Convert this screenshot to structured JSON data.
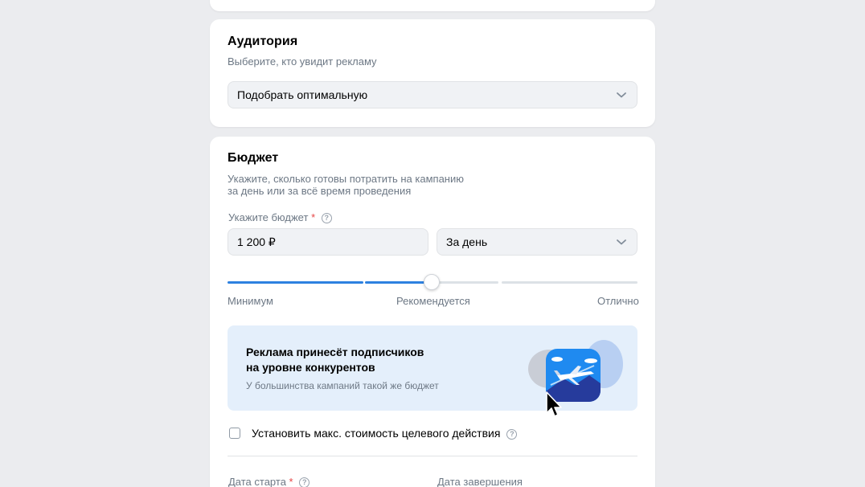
{
  "audience": {
    "title": "Аудитория",
    "subtitle": "Выберите, кто увидит рекламу",
    "select_value": "Подобрать оптимальную"
  },
  "budget": {
    "title": "Бюджет",
    "subtitle_line1": "Укажите, сколько готовы потратить на кампанию",
    "subtitle_line2": "за день или за всё время проведения",
    "field_label": "Укажите бюджет",
    "required_mark": "*",
    "amount_value": "1 200 ₽",
    "period_value": "За день",
    "slider": {
      "level_percent": 50,
      "labels": [
        "Минимум",
        "Рекомендуется",
        "Отлично"
      ]
    },
    "banner": {
      "title_line1": "Реклама принесёт подписчиков",
      "title_line2": "на уровне конкурентов",
      "text": "У большинства кампаний такой же бюджет",
      "image_icon": "airplane-illustration-icon"
    },
    "max_cost_checkbox": {
      "label": "Установить макс. стоимость целевого действия",
      "checked": false
    },
    "start_date_label": "Дата старта",
    "end_date_label": "Дата завершения"
  },
  "help_glyph": "?",
  "colors": {
    "accent": "#2d81e0",
    "track_inactive": "#dce1e6",
    "banner_bg": "#e4effb",
    "page_bg": "#ebecef"
  }
}
